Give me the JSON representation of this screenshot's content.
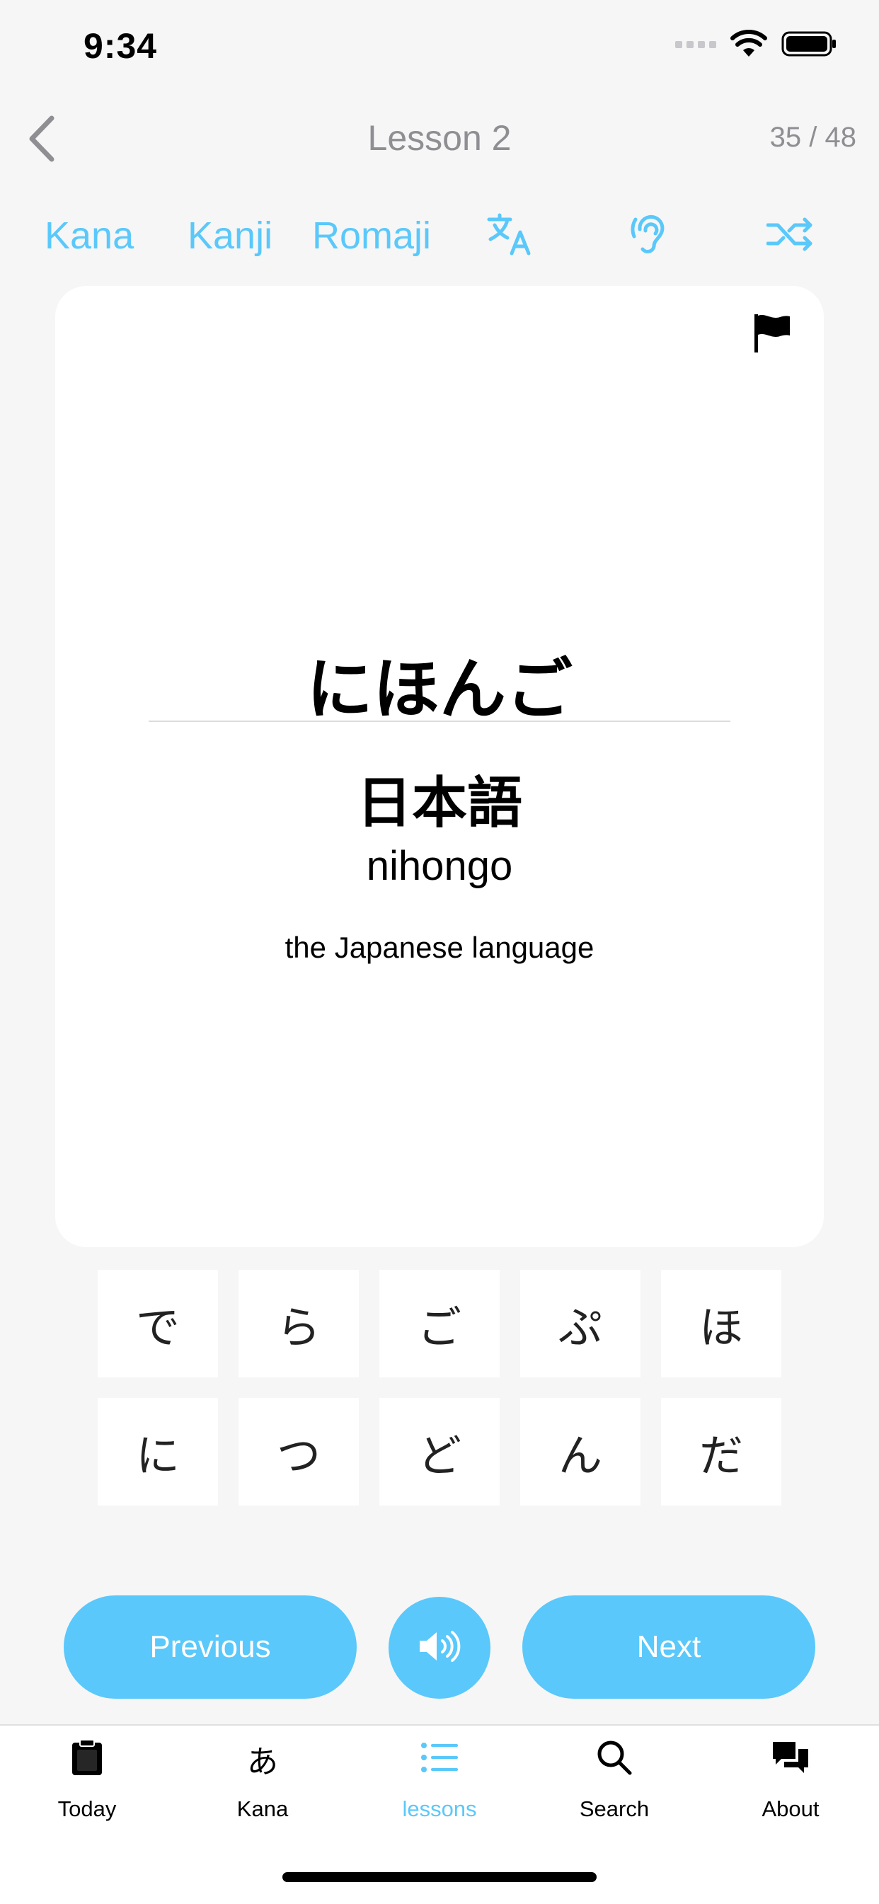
{
  "status_bar": {
    "time": "9:34"
  },
  "nav": {
    "title": "Lesson 2",
    "counter": "35 / 48"
  },
  "modes": {
    "kana": "Kana",
    "kanji": "Kanji",
    "romaji": "Romaji"
  },
  "toolbar_icons": [
    "translate-icon",
    "hearing-icon",
    "shuffle-icon"
  ],
  "card": {
    "kana": "にほんご",
    "kanji": "日本語",
    "romaji": "nihongo",
    "meaning": "the Japanese language"
  },
  "tiles": [
    "で",
    "ら",
    "ご",
    "ぷ",
    "ほ",
    "に",
    "つ",
    "ど",
    "ん",
    "だ"
  ],
  "buttons": {
    "previous": "Previous",
    "next": "Next"
  },
  "tabs": [
    {
      "label": "Today",
      "icon": "clipboard-icon"
    },
    {
      "label": "Kana",
      "icon": "hiragana-a-icon",
      "glyph": "あ"
    },
    {
      "label": "lessons",
      "icon": "list-icon"
    },
    {
      "label": "Search",
      "icon": "search-icon"
    },
    {
      "label": "About",
      "icon": "chat-bubbles-icon"
    }
  ],
  "active_tab": "lessons",
  "colors": {
    "accent": "#5ac8fa",
    "background": "#f6f6f6",
    "card": "#ffffff",
    "muted": "#8e8e93"
  }
}
